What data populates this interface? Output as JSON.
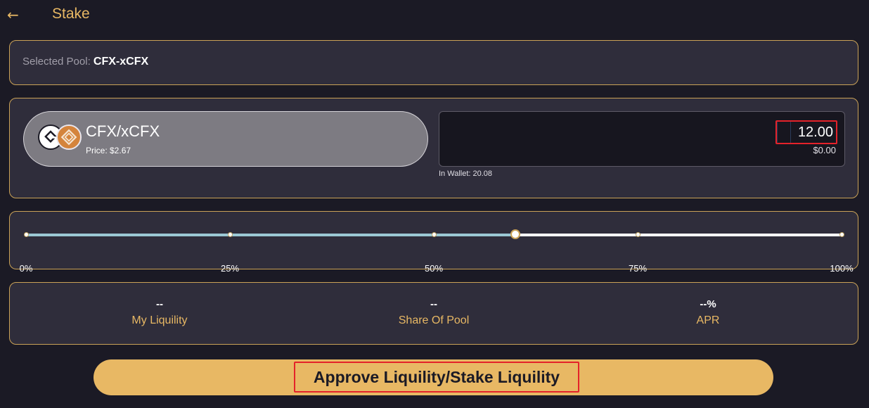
{
  "header": {
    "back_icon": "arrow-left-icon",
    "title": "Stake"
  },
  "pool": {
    "label": "Selected Pool:",
    "value": "CFX-xCFX"
  },
  "token": {
    "name": "CFX/xCFX",
    "price": "Price: $2.67",
    "icons": [
      "cfx-token-icon",
      "xcfx-token-icon"
    ]
  },
  "amount": {
    "value": "12.00",
    "usd": "$0.00",
    "wallet": "In Wallet: 20.08"
  },
  "slider": {
    "percent": 60,
    "ticks": [
      "0%",
      "25%",
      "50%",
      "75%",
      "100%"
    ]
  },
  "stats": [
    {
      "value": "--",
      "label": "My Liquility"
    },
    {
      "value": "--",
      "label": "Share Of Pool"
    },
    {
      "value": "--%",
      "label": "APR"
    }
  ],
  "approve_button": {
    "label": "Approve Liquility/Stake Liquility"
  },
  "colors": {
    "accent": "#e8b864",
    "background": "#1b1a25",
    "card": "#2f2d3b",
    "highlight": "#e4222a"
  }
}
